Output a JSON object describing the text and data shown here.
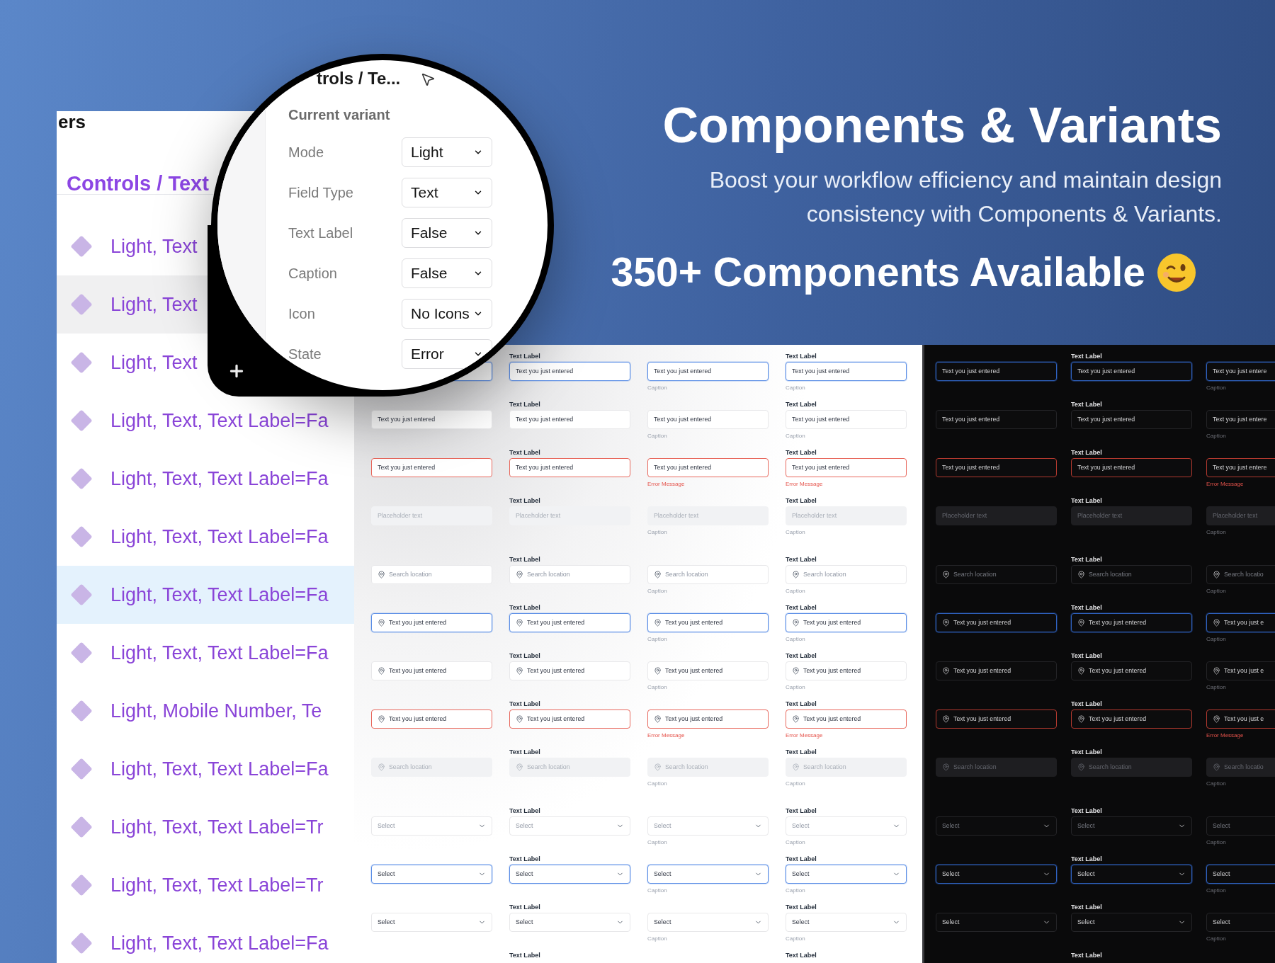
{
  "hero": {
    "title": "Components & Variants",
    "subtitle_lines": [
      "Boost your workflow efficiency and maintain design",
      "consistency with Components & Variants."
    ],
    "headline": "350+ Components Available"
  },
  "layers_panel": {
    "heading": "ers",
    "title": "Controls / Text",
    "items": [
      {
        "label": "Light, Text",
        "selected": false,
        "hovered": false
      },
      {
        "label": "Light, Text",
        "selected": false,
        "hovered": true
      },
      {
        "label": "Light, Text",
        "selected": false,
        "hovered": false
      },
      {
        "label": "Light, Text, Text Label=Fa",
        "selected": false,
        "hovered": false
      },
      {
        "label": "Light, Text, Text Label=Fa",
        "selected": false,
        "hovered": false
      },
      {
        "label": "Light, Text, Text Label=Fa",
        "selected": false,
        "hovered": false
      },
      {
        "label": "Light, Text, Text Label=Fa",
        "selected": true,
        "hovered": false
      },
      {
        "label": "Light, Text, Text Label=Fa",
        "selected": false,
        "hovered": false
      },
      {
        "label": "Light, Mobile Number, Te",
        "selected": false,
        "hovered": false
      },
      {
        "label": "Light, Text, Text Label=Fa",
        "selected": false,
        "hovered": false
      },
      {
        "label": "Light, Text, Text Label=Tr",
        "selected": false,
        "hovered": false
      },
      {
        "label": "Light, Text, Text Label=Tr",
        "selected": false,
        "hovered": false
      },
      {
        "label": "Light, Text, Text Label=Fa",
        "selected": false,
        "hovered": false
      }
    ]
  },
  "magnifier": {
    "breadcrumb": "trols / Te...",
    "section_title": "Current variant",
    "properties": [
      {
        "name": "Mode",
        "value": "Light"
      },
      {
        "name": "Field Type",
        "value": "Text"
      },
      {
        "name": "Text Label",
        "value": "False"
      },
      {
        "name": "Caption",
        "value": "False"
      },
      {
        "name": "Icon",
        "value": "No Icons"
      },
      {
        "name": "State",
        "value": "Error"
      }
    ]
  },
  "light_sheet": {
    "rows": [
      {
        "kind": "text",
        "focused": true,
        "error": false,
        "disabled": false,
        "cells": [
          {},
          {
            "label": "Text Label",
            "value": "Text you just entered"
          },
          {
            "value": "Text you just entered",
            "caption": "Caption"
          },
          {
            "label": "Text Label",
            "value": "Text you just entered",
            "caption": "Caption"
          }
        ]
      },
      {
        "kind": "text",
        "focused": false,
        "error": false,
        "disabled": false,
        "cells": [
          {
            "value": "Text you just entered"
          },
          {
            "label": "Text Label",
            "value": "Text you just entered"
          },
          {
            "value": "Text you just entered",
            "caption": "Caption"
          },
          {
            "label": "Text Label",
            "value": "Text you just entered",
            "caption": "Caption"
          }
        ]
      },
      {
        "kind": "text",
        "focused": false,
        "error": true,
        "disabled": false,
        "cells": [
          {
            "value": "Text you just entered"
          },
          {
            "label": "Text Label",
            "value": "Text you just entered"
          },
          {
            "value": "Text you just entered",
            "caption": "Error Message"
          },
          {
            "label": "Text Label",
            "value": "Text you just entered",
            "caption": "Error Message"
          }
        ]
      },
      {
        "kind": "text",
        "focused": false,
        "error": false,
        "disabled": true,
        "cells": [
          {
            "placeholder": "Placeholder text"
          },
          {
            "label": "Text Label",
            "placeholder": "Placeholder text"
          },
          {
            "placeholder": "Placeholder text",
            "caption": "Caption"
          },
          {
            "label": "Text Label",
            "placeholder": "Placeholder text",
            "caption": "Caption"
          }
        ]
      },
      {
        "kind": "location",
        "focused": false,
        "error": false,
        "disabled": false,
        "cells": [
          {
            "placeholder": "Search location"
          },
          {
            "label": "Text Label",
            "placeholder": "Search location"
          },
          {
            "placeholder": "Search location",
            "caption": "Caption"
          },
          {
            "label": "Text Label",
            "placeholder": "Search location",
            "caption": "Caption"
          }
        ]
      },
      {
        "kind": "location",
        "focused": true,
        "error": false,
        "disabled": false,
        "cells": [
          {
            "value": "Text you just entered"
          },
          {
            "label": "Text Label",
            "value": "Text you just entered"
          },
          {
            "value": "Text you just entered",
            "caption": "Caption"
          },
          {
            "label": "Text Label",
            "value": "Text you just entered",
            "caption": "Caption"
          }
        ]
      },
      {
        "kind": "location",
        "focused": false,
        "error": false,
        "disabled": false,
        "cells": [
          {
            "value": "Text you just entered"
          },
          {
            "label": "Text Label",
            "value": "Text you just entered"
          },
          {
            "value": "Text you just entered",
            "caption": "Caption"
          },
          {
            "label": "Text Label",
            "value": "Text you just entered",
            "caption": "Caption"
          }
        ]
      },
      {
        "kind": "location",
        "focused": false,
        "error": true,
        "disabled": false,
        "cells": [
          {
            "value": "Text you just entered"
          },
          {
            "label": "Text Label",
            "value": "Text you just entered"
          },
          {
            "value": "Text you just entered",
            "caption": "Error Message"
          },
          {
            "label": "Text Label",
            "value": "Text you just entered",
            "caption": "Error Message"
          }
        ]
      },
      {
        "kind": "location",
        "focused": false,
        "error": false,
        "disabled": true,
        "cells": [
          {
            "placeholder": "Search location"
          },
          {
            "label": "Text Label",
            "placeholder": "Search location"
          },
          {
            "placeholder": "Search location",
            "caption": "Caption"
          },
          {
            "label": "Text Label",
            "placeholder": "Search location",
            "caption": "Caption"
          }
        ]
      },
      {
        "kind": "select",
        "focused": false,
        "error": false,
        "disabled": false,
        "cells": [
          {
            "placeholder": "Select"
          },
          {
            "label": "Text Label",
            "placeholder": "Select"
          },
          {
            "placeholder": "Select",
            "caption": "Caption"
          },
          {
            "label": "Text Label",
            "placeholder": "Select",
            "caption": "Caption"
          }
        ]
      },
      {
        "kind": "select",
        "focused": true,
        "error": false,
        "disabled": false,
        "cells": [
          {
            "value": "Select"
          },
          {
            "label": "Text Label",
            "value": "Select"
          },
          {
            "value": "Select",
            "caption": "Caption"
          },
          {
            "label": "Text Label",
            "value": "Select",
            "caption": "Caption"
          }
        ]
      },
      {
        "kind": "select",
        "focused": false,
        "error": false,
        "disabled": false,
        "cells": [
          {
            "value": "Select"
          },
          {
            "label": "Text Label",
            "value": "Select"
          },
          {
            "value": "Select",
            "caption": "Caption"
          },
          {
            "label": "Text Label",
            "value": "Select",
            "caption": "Caption"
          }
        ]
      },
      {
        "kind": "cut",
        "cells": [
          {},
          {
            "label": "Text Label"
          },
          {},
          {
            "label": "Text Label"
          }
        ]
      }
    ]
  },
  "dark_sheet": {
    "rows": [
      {
        "kind": "text",
        "focused": true,
        "error": false,
        "disabled": false,
        "cells": [
          {
            "value": "Text you just entered"
          },
          {
            "label": "Text Label",
            "value": "Text you just entered"
          },
          {
            "value": "Text you just entere",
            "caption": "Caption"
          }
        ]
      },
      {
        "kind": "text",
        "focused": false,
        "error": false,
        "disabled": false,
        "cells": [
          {
            "value": "Text you just entered"
          },
          {
            "label": "Text Label",
            "value": "Text you just entered"
          },
          {
            "value": "Text you just entere",
            "caption": "Caption"
          }
        ]
      },
      {
        "kind": "text",
        "focused": false,
        "error": true,
        "disabled": false,
        "cells": [
          {
            "value": "Text you just entered"
          },
          {
            "label": "Text Label",
            "value": "Text you just entered"
          },
          {
            "value": "Text you just entere",
            "caption": "Error Message"
          }
        ]
      },
      {
        "kind": "text",
        "focused": false,
        "error": false,
        "disabled": true,
        "cells": [
          {
            "placeholder": "Placeholder text"
          },
          {
            "label": "Text Label",
            "placeholder": "Placeholder text"
          },
          {
            "placeholder": "Placeholder text",
            "caption": "Caption"
          }
        ]
      },
      {
        "kind": "location",
        "focused": false,
        "error": false,
        "disabled": false,
        "cells": [
          {
            "placeholder": "Search location"
          },
          {
            "label": "Text Label",
            "placeholder": "Search location"
          },
          {
            "placeholder": "Search locatio",
            "caption": "Caption"
          }
        ]
      },
      {
        "kind": "location",
        "focused": true,
        "error": false,
        "disabled": false,
        "cells": [
          {
            "value": "Text you just entered"
          },
          {
            "label": "Text Label",
            "value": "Text you just entered"
          },
          {
            "value": "Text you just e",
            "caption": "Caption"
          }
        ]
      },
      {
        "kind": "location",
        "focused": false,
        "error": false,
        "disabled": false,
        "cells": [
          {
            "value": "Text you just entered"
          },
          {
            "label": "Text Label",
            "value": "Text you just entered"
          },
          {
            "value": "Text you just e",
            "caption": "Caption"
          }
        ]
      },
      {
        "kind": "location",
        "focused": false,
        "error": true,
        "disabled": false,
        "cells": [
          {
            "value": "Text you just entered"
          },
          {
            "label": "Text Label",
            "value": "Text you just entered"
          },
          {
            "value": "Text you just e",
            "caption": "Error Message"
          }
        ]
      },
      {
        "kind": "location",
        "focused": false,
        "error": false,
        "disabled": true,
        "cells": [
          {
            "placeholder": "Search location"
          },
          {
            "label": "Text Label",
            "placeholder": "Search location"
          },
          {
            "placeholder": "Search locatio",
            "caption": "Caption"
          }
        ]
      },
      {
        "kind": "select",
        "focused": false,
        "error": false,
        "disabled": false,
        "cells": [
          {
            "placeholder": "Select"
          },
          {
            "label": "Text Label",
            "placeholder": "Select"
          },
          {
            "placeholder": "Select",
            "caption": "Caption"
          }
        ]
      },
      {
        "kind": "select",
        "focused": true,
        "error": false,
        "disabled": false,
        "cells": [
          {
            "value": "Select"
          },
          {
            "label": "Text Label",
            "value": "Select"
          },
          {
            "value": "Select",
            "caption": "Caption"
          }
        ]
      },
      {
        "kind": "select",
        "focused": false,
        "error": false,
        "disabled": false,
        "cells": [
          {
            "value": "Select"
          },
          {
            "label": "Text Label",
            "value": "Select"
          },
          {
            "value": "Select",
            "caption": "Caption"
          }
        ]
      },
      {
        "kind": "cut",
        "cells": [
          {},
          {
            "label": "Text Label"
          },
          {}
        ]
      }
    ]
  }
}
